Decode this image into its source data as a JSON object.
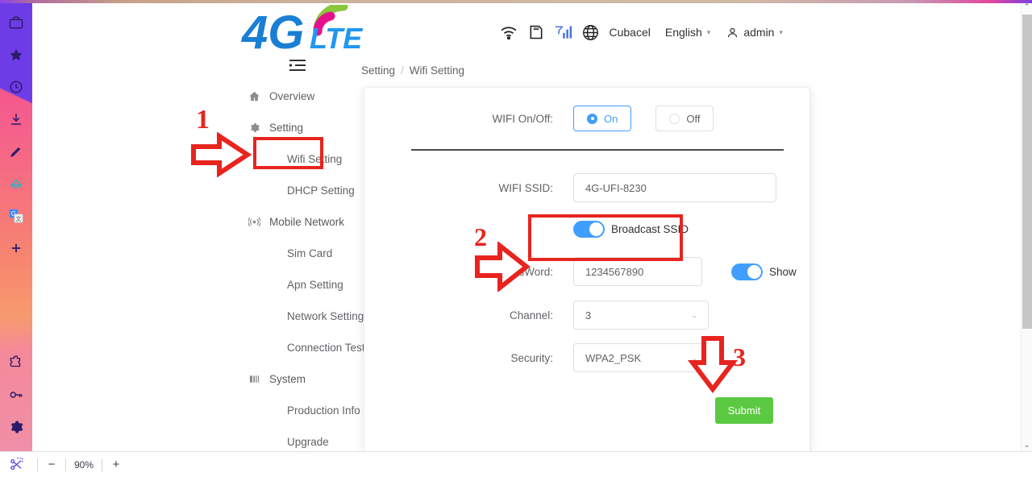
{
  "browser": {
    "rail_icons": [
      "briefcase-icon",
      "star-icon",
      "history-icon",
      "download-icon",
      "pen-icon",
      "cloud-icon",
      "translate-icon",
      "add-icon",
      "extension-icon",
      "key-icon",
      "settings-icon"
    ],
    "bottom_bar": {
      "snip_icon": "snip-scissors-icon",
      "zoom_out_label": "−",
      "zoom_level": "90%",
      "zoom_in_label": "+"
    },
    "scrollbar": {
      "up_arrow": "⌃",
      "down_arrow": "⌄"
    }
  },
  "header": {
    "logo_text_4g": "4G",
    "logo_text_lte": "LTE",
    "collapse_icon": "collapse-menu-icon",
    "icons": [
      "wifi-icon",
      "sim-card-icon",
      "signal-bars-icon",
      "globe-icon"
    ],
    "carrier": "Cubacel",
    "language": "English",
    "user": "admin",
    "caret": "▾"
  },
  "breadcrumb": {
    "parent": "Setting",
    "separator": "/",
    "current": "Wifi Setting"
  },
  "sidebar": {
    "items": [
      {
        "label": "Overview",
        "icon": "home-icon",
        "type": "top",
        "arrow": ""
      },
      {
        "label": "Setting",
        "icon": "gear-icon",
        "type": "group",
        "arrow": "⌃"
      },
      {
        "label": "Wifi Setting",
        "icon": "",
        "type": "sub",
        "arrow": ""
      },
      {
        "label": "DHCP Setting",
        "icon": "",
        "type": "sub",
        "arrow": ""
      },
      {
        "label": "Mobile Network",
        "icon": "signal-tower-icon",
        "type": "group",
        "arrow": "⌃"
      },
      {
        "label": "Sim Card",
        "icon": "",
        "type": "sub",
        "arrow": ""
      },
      {
        "label": "Apn Setting",
        "icon": "",
        "type": "sub",
        "arrow": ""
      },
      {
        "label": "Network Setting",
        "icon": "",
        "type": "sub",
        "arrow": ""
      },
      {
        "label": "Connection Test",
        "icon": "",
        "type": "sub",
        "arrow": ""
      },
      {
        "label": "System",
        "icon": "server-icon",
        "type": "group",
        "arrow": "⌃"
      },
      {
        "label": "Production Info",
        "icon": "",
        "type": "sub",
        "arrow": ""
      },
      {
        "label": "Upgrade",
        "icon": "",
        "type": "sub",
        "arrow": ""
      }
    ]
  },
  "form": {
    "wifi_onoff_label": "WIFI On/Off:",
    "wifi_on_label": "On",
    "wifi_off_label": "Off",
    "wifi_selected": "On",
    "ssid_label": "WIFI SSID:",
    "ssid_value": "4G-UFI-8230",
    "broadcast_label": "Broadcast SSID",
    "broadcast_on": true,
    "password_label": "PassWord:",
    "password_value": "1234567890",
    "show_label": "Show",
    "show_on": true,
    "channel_label": "Channel:",
    "channel_value": "3",
    "security_label": "Security:",
    "security_value": "WPA2_PSK",
    "submit_label": "Submit",
    "chevron": "⌄"
  },
  "annotations": {
    "step1": "1",
    "step2": "2",
    "step3": "3",
    "accent_red": "#e8241f",
    "accent_green": "#5cc943",
    "accent_blue": "#409eff"
  }
}
